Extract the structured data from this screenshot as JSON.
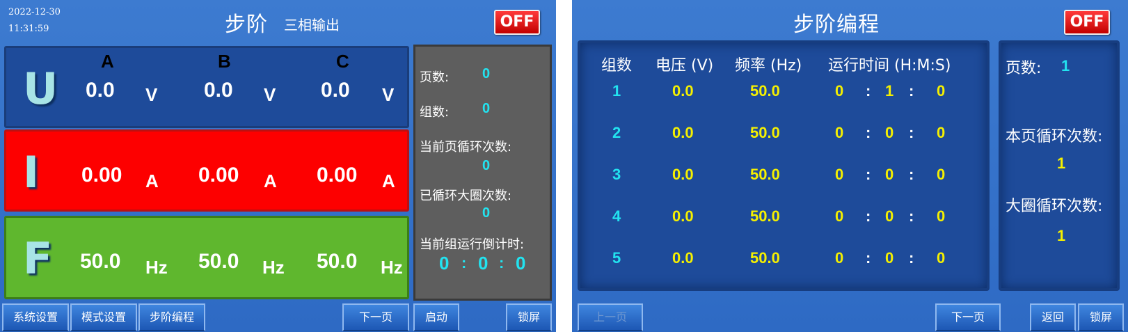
{
  "left": {
    "date": "2022-12-30",
    "time": "11:31:59",
    "title": "步阶",
    "subtitle": "三相输出",
    "off_label": "OFF",
    "phases": [
      "A",
      "B",
      "C"
    ],
    "rows": {
      "u": {
        "letter": "U",
        "values": [
          "0.0",
          "0.0",
          "0.0"
        ],
        "unit": "V"
      },
      "i": {
        "letter": "I",
        "values": [
          "0.00",
          "0.00",
          "0.00"
        ],
        "unit": "A"
      },
      "f": {
        "letter": "F",
        "values": [
          "50.0",
          "50.0",
          "50.0"
        ],
        "unit": "Hz"
      }
    },
    "status": {
      "page_label": "页数:",
      "page_value": "0",
      "group_label": "组数:",
      "group_value": "0",
      "page_loop_label": "当前页循环次数:",
      "page_loop_value": "0",
      "big_loop_label": "已循环大圈次数:",
      "big_loop_value": "0",
      "countdown_label": "当前组运行倒计时:",
      "countdown_h": "0",
      "countdown_m": "0",
      "countdown_s": "0",
      "sep": ":"
    },
    "buttons": {
      "system": "系统设置",
      "mode": "模式设置",
      "step_program": "步阶编程",
      "next_page": "下一页",
      "start": "启动",
      "lock": "锁屏"
    }
  },
  "right": {
    "title": "步阶编程",
    "off_label": "OFF",
    "headers": {
      "group": "组数",
      "voltage": "电压 (V)",
      "freq": "频率 (Hz)",
      "runtime": "运行时间 (H:M:S)"
    },
    "rows": [
      {
        "idx": "1",
        "voltage": "0.0",
        "freq": "50.0",
        "h": "0",
        "m": "1",
        "s": "0"
      },
      {
        "idx": "2",
        "voltage": "0.0",
        "freq": "50.0",
        "h": "0",
        "m": "0",
        "s": "0"
      },
      {
        "idx": "3",
        "voltage": "0.0",
        "freq": "50.0",
        "h": "0",
        "m": "0",
        "s": "0"
      },
      {
        "idx": "4",
        "voltage": "0.0",
        "freq": "50.0",
        "h": "0",
        "m": "0",
        "s": "0"
      },
      {
        "idx": "5",
        "voltage": "0.0",
        "freq": "50.0",
        "h": "0",
        "m": "0",
        "s": "0"
      }
    ],
    "sep": ":",
    "side": {
      "page_label": "页数:",
      "page_value": "1",
      "page_loop_label": "本页循环次数:",
      "page_loop_value": "1",
      "big_loop_label": "大圈循环次数:",
      "big_loop_value": "1"
    },
    "buttons": {
      "prev_page": "上一页",
      "next_page": "下一页",
      "back": "返回",
      "lock": "锁屏"
    }
  }
}
